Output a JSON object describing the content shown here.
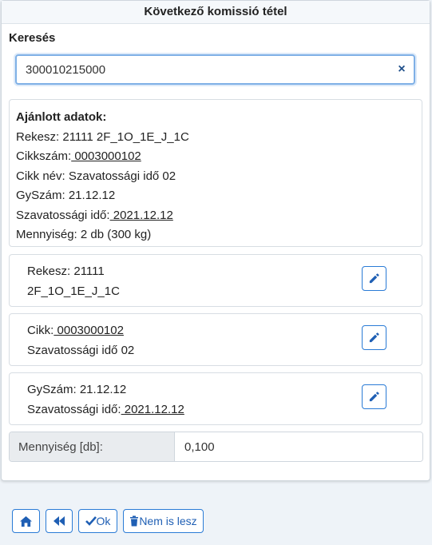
{
  "header": {
    "title": "Következő komissió tétel"
  },
  "search": {
    "label": "Keresés",
    "value": "300010215000",
    "clear_icon": "×"
  },
  "suggested": {
    "title": "Ajánlott adatok:",
    "rekesz": "Rekesz: 21111 2F_1O_1E_J_1C",
    "cikkszam_label": "Cikkszám:",
    "cikkszam_value": " 0003000102",
    "cikk_nev": "Cikk név: Szavatossági idő 02",
    "gyszam": "GySzám: 21.12.12",
    "szavatossag_label": "Szavatossági idő:",
    "szavatossag_value": " 2021.12.12",
    "mennyiseg": "Mennyiség: 2 db (300 kg)"
  },
  "items": [
    {
      "line1_prefix": "Rekesz: 21111",
      "line1_link": "",
      "line2": "2F_1O_1E_J_1C",
      "line2_prefix": "",
      "line2_link": ""
    },
    {
      "line1_prefix": "Cikk:",
      "line1_link": " 0003000102",
      "line2": "Szavatossági idő 02",
      "line2_prefix": "",
      "line2_link": ""
    },
    {
      "line1_prefix": "GySzám: 21.12.12",
      "line1_link": "",
      "line2": "",
      "line2_prefix": "Szavatossági idő:",
      "line2_link": " 2021.12.12"
    }
  ],
  "quantity": {
    "label": "Mennyiség [db]:",
    "value": "0,100"
  },
  "buttons": {
    "home_icon": "home-icon",
    "back_icon": "fast-backward-icon",
    "ok_label": "Ok",
    "cancel_label": "Nem is lesz"
  },
  "colors": {
    "accent": "#2a7bd6",
    "icon": "#1f5fb4"
  }
}
